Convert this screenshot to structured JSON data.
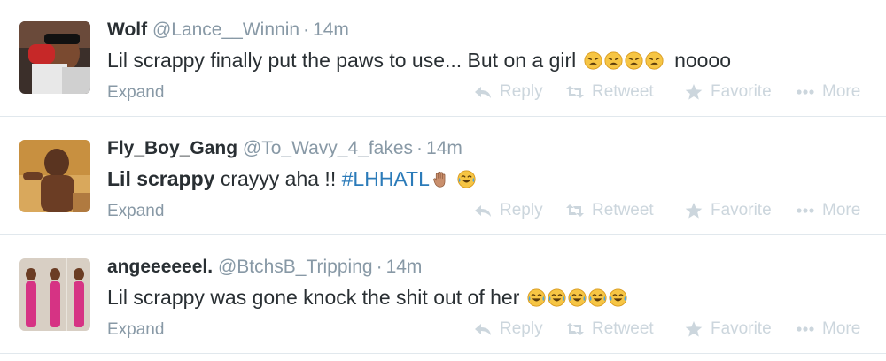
{
  "tweets": [
    {
      "name": "Wolf",
      "handle": "@Lance__Winnin",
      "separator": "·",
      "time": "14m",
      "text_before": "Lil scrappy finally put the paws to use... But on a girl",
      "text_after": "noooo",
      "emoji_names": [
        "weary-face-icon",
        "weary-face-icon",
        "weary-face-icon",
        "weary-face-icon"
      ],
      "expand": "Expand"
    },
    {
      "name": "Fly_Boy_Gang",
      "handle": "@To_Wavy_4_fakes",
      "separator": "·",
      "time": "14m",
      "text_bold": "Lil scrappy",
      "text_plain": "crayyy aha !!",
      "hashtag": "#LHHATL",
      "emoji_names": [
        "raised-hand-icon",
        "crying-laughing-face-icon"
      ],
      "expand": "Expand"
    },
    {
      "name": "angeeeeeel.",
      "handle": "@BtchsB_Tripping",
      "separator": "·",
      "time": "14m",
      "text_before": "Lil scrappy was gone knock the shit out of her",
      "emoji_names": [
        "crying-laughing-face-icon",
        "crying-laughing-face-icon",
        "crying-laughing-face-icon",
        "crying-laughing-face-icon",
        "crying-laughing-face-icon"
      ],
      "expand": "Expand"
    }
  ],
  "actions": {
    "reply": "Reply",
    "retweet": "Retweet",
    "favorite": "Favorite",
    "more": "More"
  },
  "colors": {
    "name": "#292f33",
    "meta": "#8899a6",
    "hashtag": "#2b7bb9",
    "action": "#ccd6dd",
    "divider": "#e1e8ed"
  }
}
